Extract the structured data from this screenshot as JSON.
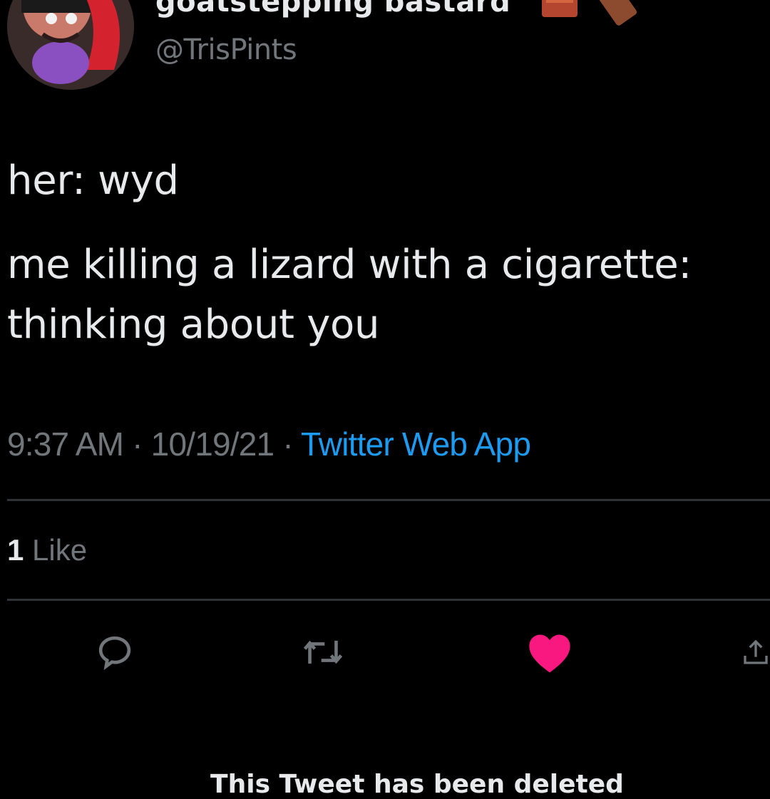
{
  "user": {
    "display_name": "goatstepping bastard",
    "handle": "@TrisPints",
    "avatar_icon": "avatar-image",
    "name_emoji_icon": "brick-emoji-icon"
  },
  "tweet": {
    "lines": [
      "her: wyd",
      "me killing a lizard with a cigarette:",
      "thinking about you"
    ],
    "time": "9:37 AM",
    "separator": "·",
    "date": "10/19/21",
    "source": "Twitter Web App"
  },
  "stats": {
    "like_count": "1",
    "like_label": "Like"
  },
  "actions": {
    "reply_icon": "reply-icon",
    "retweet_icon": "retweet-icon",
    "like_icon": "heart-icon",
    "share_icon": "share-icon"
  },
  "colors": {
    "background": "#000000",
    "text": "#e7e9ea",
    "muted": "#71767b",
    "link": "#1d9bf0",
    "liked": "#f91880",
    "divider": "#2f3336"
  },
  "notice": {
    "deleted_text": "This Tweet has been deleted"
  }
}
